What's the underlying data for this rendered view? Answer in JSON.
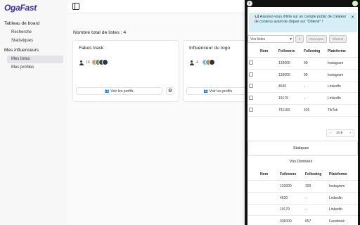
{
  "app": {
    "logo": "OgaFast"
  },
  "sidebar": {
    "group1": "Tableau de board",
    "group1_items": [
      {
        "label": "Recherche"
      },
      {
        "label": "Statistiques"
      }
    ],
    "group2": "Mes influenceurs",
    "group2_items": [
      {
        "label": "Mes listes",
        "active": true
      },
      {
        "label": "Mes profiles"
      }
    ]
  },
  "main": {
    "count_label": "Nombre total de listes : 4",
    "cards": [
      {
        "title": "Fakes track",
        "count": "16",
        "button": "Voir les profils"
      },
      {
        "title": "Influenceur du togo",
        "count": "4",
        "button": "Voir les profils"
      }
    ]
  },
  "popup": {
    "notice": "📢 Assurez-vous d'être sur un compte public de créateur de contenu avant de cliquer sur \"Obtenir\" !",
    "close": "✕",
    "select_value": "Vos listes",
    "buttons": {
      "export": "⇩",
      "overview": "Overview",
      "get": "Obtenir"
    },
    "table1": {
      "headers": [
        "",
        "Nom",
        "Followers",
        "Following",
        "Plateforme"
      ],
      "rows": [
        [
          "",
          "",
          "133000",
          "99",
          "Instagram"
        ],
        [
          "",
          "",
          "133000",
          "99",
          "Instagram"
        ],
        [
          "",
          "",
          "4530",
          "-",
          "LinkedIn"
        ],
        [
          "",
          "",
          "19179",
          "-",
          "LinkedIn"
        ],
        [
          "",
          "",
          "741100",
          "426",
          "TikTok"
        ]
      ]
    },
    "pager": {
      "prev": "‹",
      "label": "1/19",
      "next": "›"
    },
    "stats_button": "Statiques",
    "section_title": "Vos Données",
    "table2": {
      "headers": [
        "",
        "Nom",
        "Followers",
        "Following",
        "Plateforme"
      ],
      "rows": [
        [
          "",
          "",
          "133000",
          "100",
          "Instagram"
        ],
        [
          "",
          "",
          "4530",
          "-",
          "LinkedIn"
        ],
        [
          "",
          "",
          "19179",
          "-",
          "LinkedIn"
        ],
        [
          "",
          "",
          "336000",
          "657",
          "Facebook"
        ]
      ]
    }
  },
  "colors": {
    "accent": "#3b2fa0",
    "notice_bg": "#d6eef4"
  }
}
